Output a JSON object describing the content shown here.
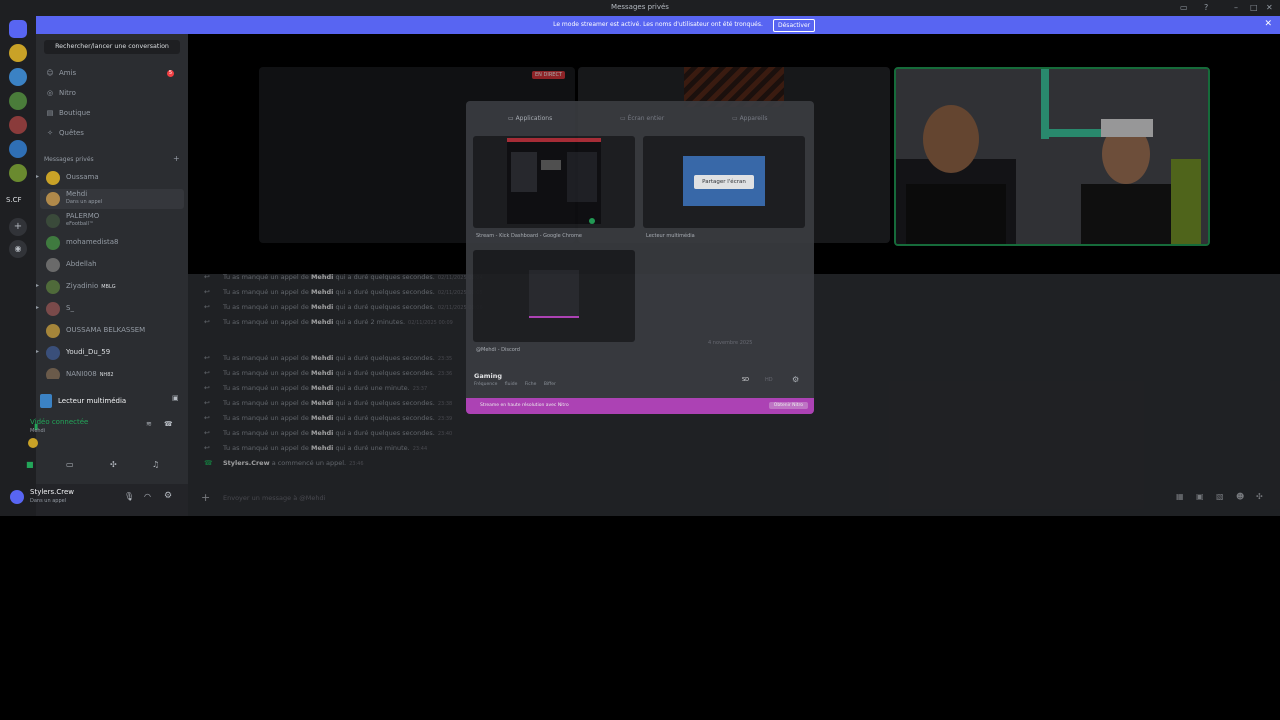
{
  "window": {
    "title": "Messages privés"
  },
  "streamer_banner": {
    "message": "Le mode streamer est activé. Les noms d'utilisateur ont été tronqués.",
    "button": "Désactiver"
  },
  "rail": {
    "label": "S.CF"
  },
  "sidebar": {
    "search_placeholder": "Rechercher/lancer une conversation",
    "nav": [
      {
        "label": "Amis",
        "badge": "5",
        "icon": "friends-icon"
      },
      {
        "label": "Nitro",
        "icon": "nitro-icon"
      },
      {
        "label": "Boutique",
        "icon": "shop-icon"
      },
      {
        "label": "Quêtes",
        "icon": "quests-icon"
      }
    ],
    "dm_section": "Messages privés",
    "dms": [
      {
        "name": "Oussama",
        "sub": ""
      },
      {
        "name": "Mehdi",
        "sub": "Dans un appel"
      },
      {
        "name": "PALERMO",
        "sub": "eFootball™"
      },
      {
        "name": "mohamedista8",
        "sub": ""
      },
      {
        "name": "Abdellah",
        "sub": ""
      },
      {
        "name": "Ziyadinio",
        "sub": "",
        "tag": "MBLG"
      },
      {
        "name": "S_",
        "sub": ""
      },
      {
        "name": "OUSSAMA BELKASSEM",
        "sub": ""
      },
      {
        "name": "Youdi_Du_59",
        "sub": ""
      },
      {
        "name": "NANI008",
        "sub": "",
        "tag": "NH82"
      }
    ],
    "media_player": "Lecteur multimédia",
    "voice": {
      "status": "Vidéo connectée",
      "channel": "Mehdi"
    },
    "user": {
      "name": "Stylers.Crew",
      "status": "Dans un appel"
    }
  },
  "stage": {
    "live_badge": "EN DIRECT"
  },
  "chat": {
    "group1": [
      {
        "pre": "Tu as manqué un appel de",
        "who": "Mehdi",
        "post": "qui a duré quelques secondes.",
        "time": "02/11/2025 00:04"
      },
      {
        "pre": "Tu as manqué un appel de",
        "who": "Mehdi",
        "post": "qui a duré quelques secondes.",
        "time": "02/11/2025 00:05"
      },
      {
        "pre": "Tu as manqué un appel de",
        "who": "Mehdi",
        "post": "qui a duré quelques secondes.",
        "time": "02/11/2025 00:06"
      },
      {
        "pre": "Tu as manqué un appel de",
        "who": "Mehdi",
        "post": "qui a duré 2 minutes.",
        "time": "02/11/2025 00:09"
      }
    ],
    "date_divider": "4 novembre 2025",
    "group2": [
      {
        "pre": "Tu as manqué un appel de",
        "who": "Mehdi",
        "post": "qui a duré quelques secondes.",
        "time": "23:35"
      },
      {
        "pre": "Tu as manqué un appel de",
        "who": "Mehdi",
        "post": "qui a duré quelques secondes.",
        "time": "23:36"
      },
      {
        "pre": "Tu as manqué un appel de",
        "who": "Mehdi",
        "post": "qui a duré une minute.",
        "time": "23:37"
      },
      {
        "pre": "Tu as manqué un appel de",
        "who": "Mehdi",
        "post": "qui a duré quelques secondes.",
        "time": "23:38"
      },
      {
        "pre": "Tu as manqué un appel de",
        "who": "Mehdi",
        "post": "qui a duré quelques secondes.",
        "time": "23:39"
      },
      {
        "pre": "Tu as manqué un appel de",
        "who": "Mehdi",
        "post": "qui a duré quelques secondes.",
        "time": "23:40"
      },
      {
        "pre": "Tu as manqué un appel de",
        "who": "Mehdi",
        "post": "qui a duré une minute.",
        "time": "23:44"
      }
    ],
    "call_started": {
      "who": "Stylers.Crew",
      "text": "a commencé un appel.",
      "time": "23:46"
    },
    "input_placeholder": "Envoyer un message à @Mehdi"
  },
  "share_modal": {
    "tabs": [
      "Applications",
      "Écran entier",
      "Appareils"
    ],
    "thumbs": [
      {
        "caption": "Stream - Kick Dashboard - Google Chrome"
      },
      {
        "caption": "Lecteur multimédia"
      },
      {
        "caption": "@Mehdi - Discord"
      }
    ],
    "share_button": "Partager l'écran",
    "activity": "Gaming",
    "activity_options": [
      "Fréquence fluide",
      "Fiche",
      "Biffer"
    ],
    "quality": [
      "SD",
      "HD"
    ],
    "nitro_text": "Streame en haute résolution avec Nitro",
    "nitro_button": "Obtenir Nitro"
  },
  "colors": {
    "accent": "#5865f2",
    "live": "#da373c",
    "connected": "#23a559",
    "nitro": "#b845c1"
  }
}
